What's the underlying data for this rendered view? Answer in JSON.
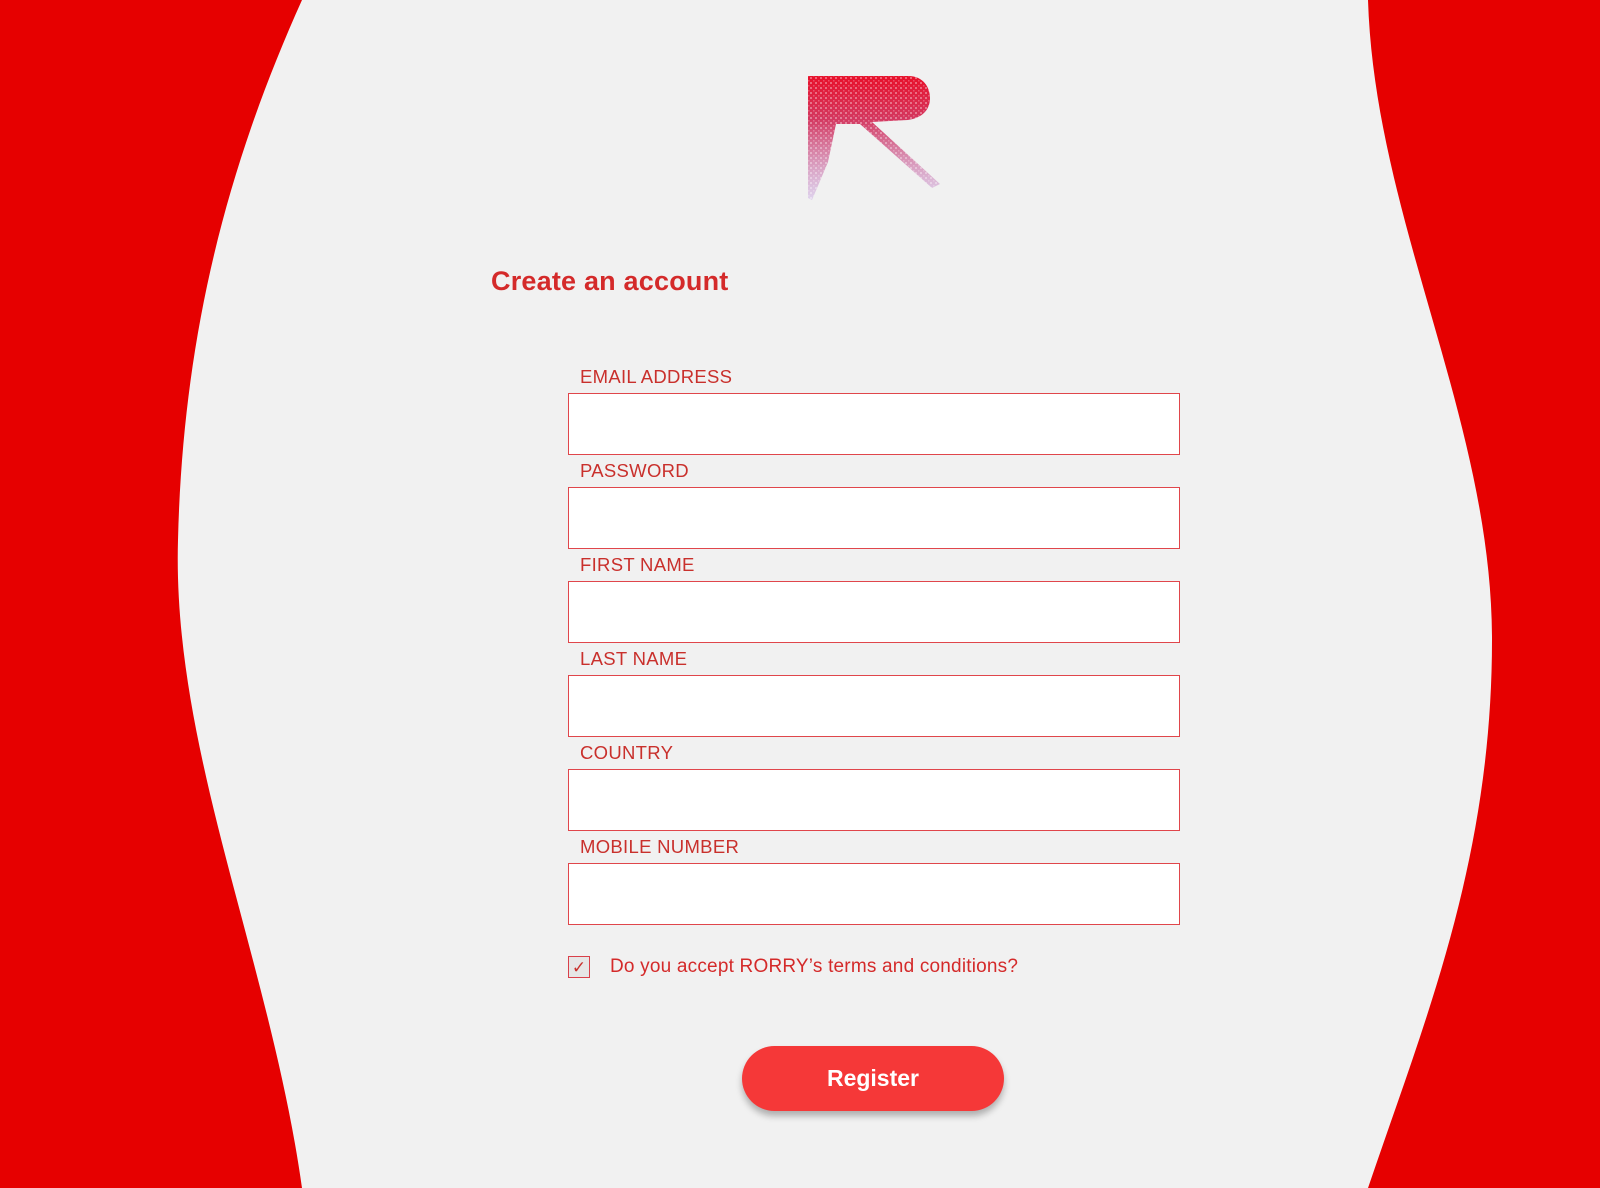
{
  "header": {
    "title": "Create an account"
  },
  "form": {
    "fields": [
      {
        "label": "EMAIL ADDRESS",
        "value": ""
      },
      {
        "label": "PASSWORD",
        "value": ""
      },
      {
        "label": "FIRST NAME",
        "value": ""
      },
      {
        "label": "LAST NAME",
        "value": ""
      },
      {
        "label": "COUNTRY",
        "value": ""
      },
      {
        "label": "MOBILE NUMBER",
        "value": ""
      }
    ],
    "terms": {
      "label": "Do you accept RORRY’s terms and conditions?",
      "checked": true,
      "check_glyph": "✓"
    },
    "register_label": "Register"
  },
  "icons": {
    "logo": "rorry-r-logo-icon",
    "checkbox_mark": "checkmark-icon"
  },
  "colors": {
    "background_side": "#E60000",
    "background_center": "#F1F1F1",
    "accent_text": "#D42A2A",
    "input_border": "#E0464B",
    "button": "#F53838",
    "button_text": "#FFFFFF"
  }
}
